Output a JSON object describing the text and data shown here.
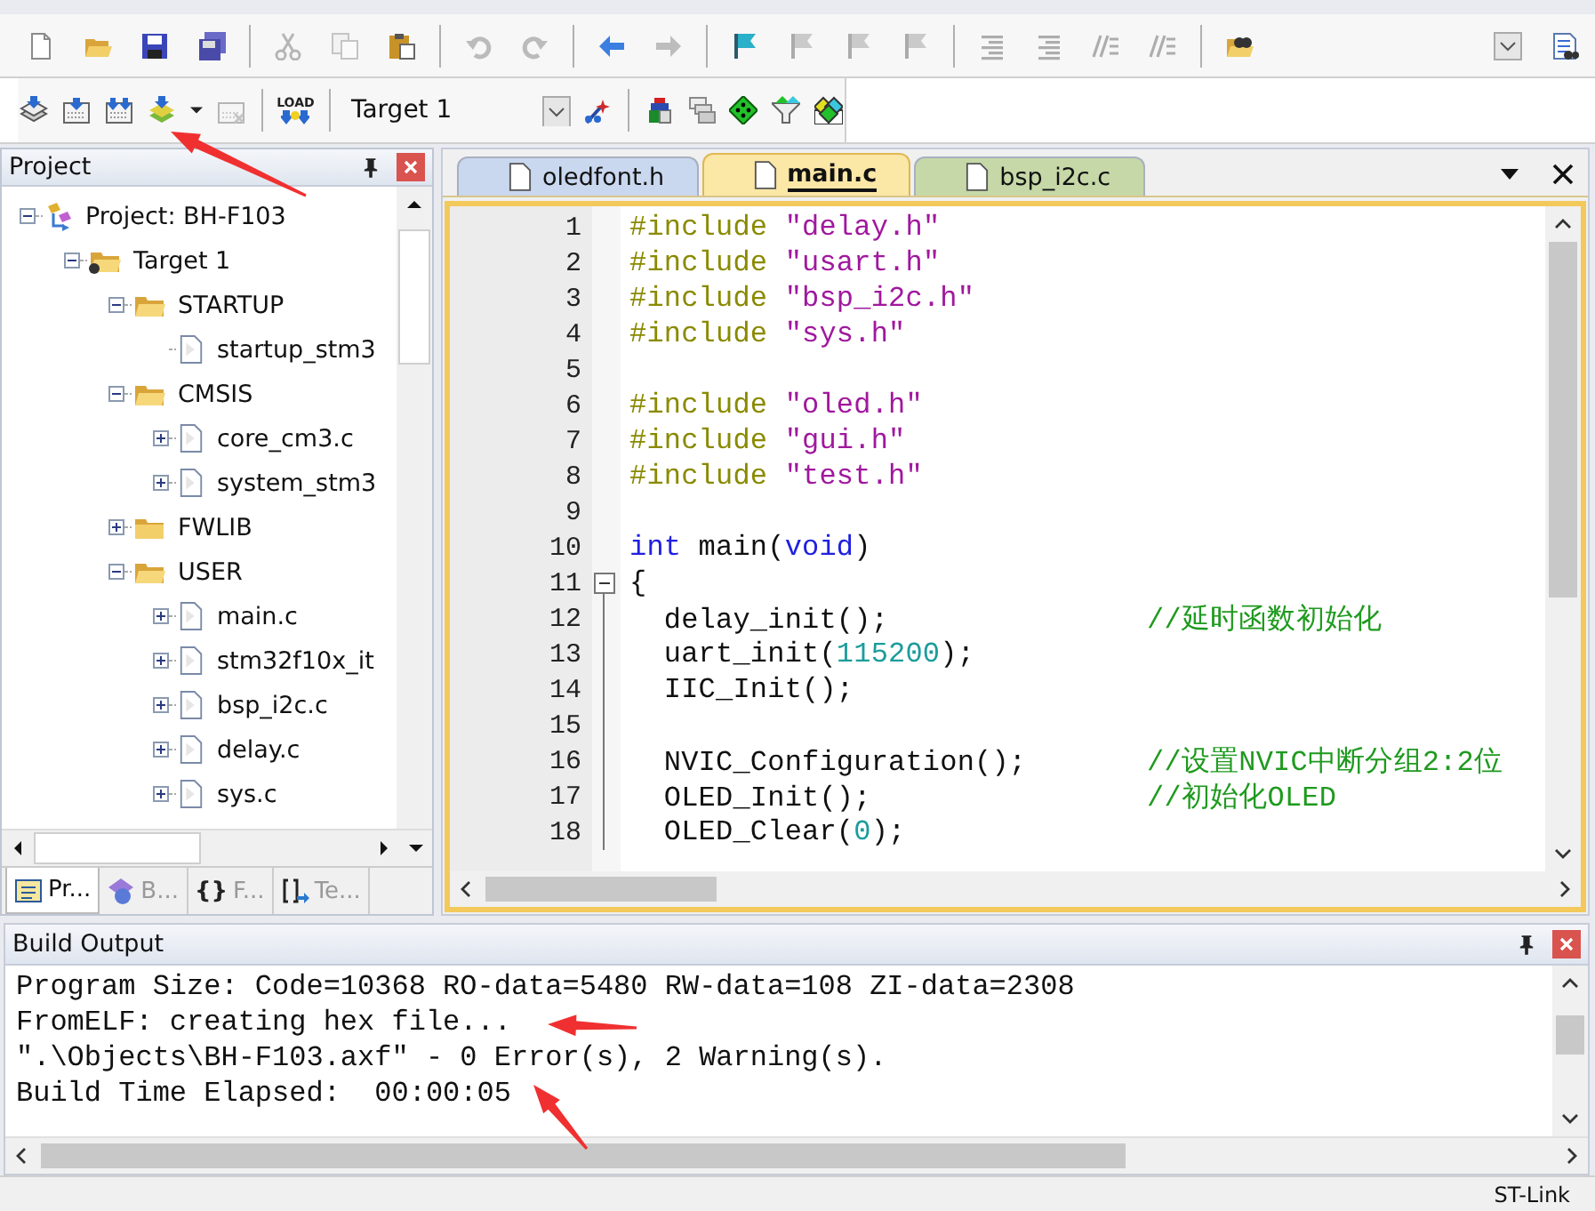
{
  "toolbar_1": [
    {
      "kind": "new",
      "disabled": false
    },
    {
      "kind": "open",
      "disabled": false
    },
    {
      "kind": "save",
      "disabled": false
    },
    {
      "kind": "save_all",
      "disabled": false
    },
    {
      "kind": "sep"
    },
    {
      "kind": "cut",
      "disabled": true
    },
    {
      "kind": "copy",
      "disabled": true
    },
    {
      "kind": "paste",
      "disabled": false
    },
    {
      "kind": "sep"
    },
    {
      "kind": "undo",
      "disabled": true
    },
    {
      "kind": "redo",
      "disabled": true
    },
    {
      "kind": "sep"
    },
    {
      "kind": "back",
      "disabled": false
    },
    {
      "kind": "forward",
      "disabled": true
    },
    {
      "kind": "sep"
    },
    {
      "kind": "bookmark",
      "disabled": false
    },
    {
      "kind": "bookmark_prev",
      "disabled": true
    },
    {
      "kind": "bookmark_next",
      "disabled": true
    },
    {
      "kind": "bookmark_clear",
      "disabled": true
    },
    {
      "kind": "sep"
    },
    {
      "kind": "indent",
      "disabled": true
    },
    {
      "kind": "unindent",
      "disabled": true
    },
    {
      "kind": "comment",
      "disabled": true
    },
    {
      "kind": "uncomment",
      "disabled": true
    },
    {
      "kind": "sep"
    },
    {
      "kind": "find_in_files",
      "disabled": false
    },
    {
      "kind": "spacer"
    },
    {
      "kind": "dropdown",
      "disabled": false
    },
    {
      "kind": "find",
      "disabled": false
    }
  ],
  "toolbar_2": [
    {
      "kind": "translate",
      "disabled": false
    },
    {
      "kind": "build",
      "disabled": false
    },
    {
      "kind": "rebuild",
      "disabled": false
    },
    {
      "kind": "batch_build",
      "disabled": false
    },
    {
      "kind": "caret",
      "disabled": false
    },
    {
      "kind": "stop",
      "disabled": true
    },
    {
      "kind": "sep"
    },
    {
      "kind": "load",
      "disabled": false,
      "label": "LOAD"
    },
    {
      "kind": "sep"
    },
    {
      "kind": "target",
      "value": "Target 1"
    },
    {
      "kind": "wand",
      "disabled": false
    },
    {
      "kind": "sep"
    },
    {
      "kind": "components",
      "disabled": false
    },
    {
      "kind": "layout",
      "disabled": false
    },
    {
      "kind": "diamond",
      "disabled": false
    },
    {
      "kind": "funnel",
      "disabled": false
    },
    {
      "kind": "diamonds",
      "disabled": false
    }
  ],
  "project_panel": {
    "title": "Project",
    "tree": [
      {
        "label": "Project: BH-F103",
        "kind": "project",
        "expanded": true,
        "children": [
          {
            "label": "Target 1",
            "kind": "target",
            "expanded": true,
            "children": [
              {
                "label": "STARTUP",
                "kind": "folder",
                "expanded": true,
                "children": [
                  {
                    "label": "startup_stm3",
                    "kind": "leaf"
                  }
                ]
              },
              {
                "label": "CMSIS",
                "kind": "folder",
                "expanded": true,
                "children": [
                  {
                    "label": "core_cm3.c",
                    "kind": "file",
                    "expanded": false
                  },
                  {
                    "label": "system_stm3",
                    "kind": "file",
                    "expanded": false
                  }
                ]
              },
              {
                "label": "FWLIB",
                "kind": "folder",
                "expanded": false
              },
              {
                "label": "USER",
                "kind": "folder",
                "expanded": true,
                "children": [
                  {
                    "label": "main.c",
                    "kind": "file",
                    "expanded": false
                  },
                  {
                    "label": "stm32f10x_it",
                    "kind": "file",
                    "expanded": false
                  },
                  {
                    "label": "bsp_i2c.c",
                    "kind": "file",
                    "expanded": false
                  },
                  {
                    "label": "delay.c",
                    "kind": "file",
                    "expanded": false
                  },
                  {
                    "label": "sys.c",
                    "kind": "file",
                    "expanded": false
                  }
                ]
              }
            ]
          }
        ]
      }
    ],
    "tabs": [
      {
        "label": "Pr...",
        "kind": "project",
        "selected": true
      },
      {
        "label": "B...",
        "kind": "books",
        "selected": false
      },
      {
        "label": "F...",
        "kind": "functions",
        "glyph": "{}",
        "selected": false
      },
      {
        "label": "Te...",
        "kind": "templates",
        "selected": false
      }
    ]
  },
  "editor": {
    "tabs": [
      {
        "label": "oledfont.h",
        "selected": false,
        "color": "#c9d7ef"
      },
      {
        "label": "main.c",
        "selected": true,
        "color": "#fbe7a6"
      },
      {
        "label": "bsp_i2c.c",
        "selected": false,
        "color": "#c6d8a8"
      }
    ],
    "lines": [
      {
        "number": "1",
        "tokens": [
          {
            "kind": "directive",
            "text": "#include"
          },
          {
            "kind": "string",
            "text": "\"delay.h\""
          }
        ]
      },
      {
        "number": "2",
        "tokens": [
          {
            "kind": "directive",
            "text": "#include"
          },
          {
            "kind": "string",
            "text": "\"usart.h\""
          }
        ]
      },
      {
        "number": "3",
        "tokens": [
          {
            "kind": "directive",
            "text": "#include"
          },
          {
            "kind": "string",
            "text": "\"bsp_i2c.h\""
          }
        ]
      },
      {
        "number": "4",
        "tokens": [
          {
            "kind": "directive",
            "text": "#include"
          },
          {
            "kind": "string",
            "text": "\"sys.h\""
          }
        ]
      },
      {
        "number": "5"
      },
      {
        "number": "6",
        "tokens": [
          {
            "kind": "directive",
            "text": "#include"
          },
          {
            "kind": "string",
            "text": "\"oled.h\""
          }
        ]
      },
      {
        "number": "7",
        "tokens": [
          {
            "kind": "directive",
            "text": "#include"
          },
          {
            "kind": "string",
            "text": "\"gui.h\""
          }
        ]
      },
      {
        "number": "8",
        "tokens": [
          {
            "kind": "directive",
            "text": "#include"
          },
          {
            "kind": "string",
            "text": "\"test.h\""
          }
        ]
      },
      {
        "number": "9"
      },
      {
        "number": "10",
        "tokens": [
          {
            "kind": "keyword",
            "text": "int"
          },
          {
            "kind": "plain",
            "text": " main("
          },
          {
            "kind": "keyword",
            "text": "void"
          },
          {
            "kind": "plain",
            "text": ")"
          }
        ]
      },
      {
        "number": "11",
        "fold": true,
        "tokens": [
          {
            "kind": "plain",
            "text": "{"
          }
        ]
      },
      {
        "number": "12",
        "tokens": [
          {
            "kind": "plain",
            "text": "  delay_init();               "
          },
          {
            "kind": "comment",
            "text": "//延时函数初始化"
          }
        ]
      },
      {
        "number": "13",
        "tokens": [
          {
            "kind": "plain",
            "text": "  uart_init("
          },
          {
            "kind": "number",
            "text": "115200"
          },
          {
            "kind": "plain",
            "text": ");"
          }
        ]
      },
      {
        "number": "14",
        "tokens": [
          {
            "kind": "plain",
            "text": "  IIC_Init();"
          }
        ]
      },
      {
        "number": "15"
      },
      {
        "number": "16",
        "tokens": [
          {
            "kind": "plain",
            "text": "  NVIC_Configuration();       "
          },
          {
            "kind": "comment",
            "text": "//设置NVIC中断分组2:2位"
          }
        ]
      },
      {
        "number": "17",
        "tokens": [
          {
            "kind": "plain",
            "text": "  OLED_Init();                "
          },
          {
            "kind": "comment",
            "text": "//初始化OLED"
          }
        ]
      },
      {
        "number": "18",
        "tokens": [
          {
            "kind": "plain",
            "text": "  OLED_Clear("
          },
          {
            "kind": "number",
            "text": "0"
          },
          {
            "kind": "plain",
            "text": ");"
          }
        ]
      }
    ]
  },
  "build_output": {
    "title": "Build Output",
    "lines": [
      "Program Size: Code=10368 RO-data=5480 RW-data=108 ZI-data=2308",
      "FromELF: creating hex file...",
      "\".\\Objects\\BH-F103.axf\" - 0 Error(s), 2 Warning(s).",
      "Build Time Elapsed:  00:00:05"
    ]
  },
  "status_bar": {
    "debugger": "ST-Link"
  },
  "annotations": [
    {
      "kind": "arrow"
    },
    {
      "kind": "arrow"
    },
    {
      "kind": "arrow"
    }
  ]
}
